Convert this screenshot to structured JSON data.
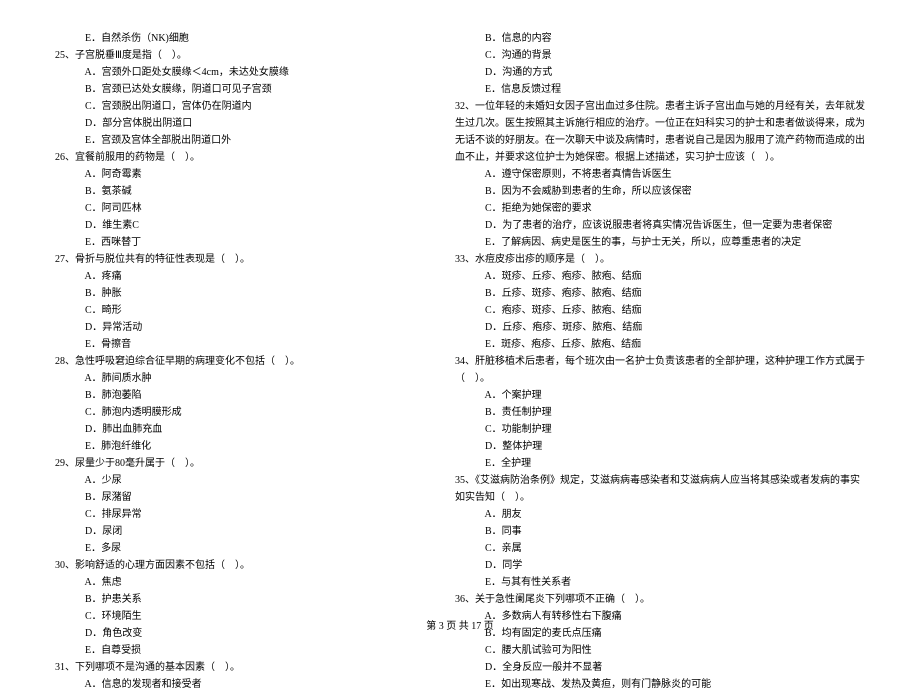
{
  "col1": [
    {
      "indent": 3,
      "text": "E．自然杀伤（NK)细胞"
    },
    {
      "indent": 0,
      "text": "25、子宫脱垂Ⅲ度是指（    ）。"
    },
    {
      "indent": 3,
      "text": "A．宫颈外口距处女膜缘＜4cm，未达处女膜缘"
    },
    {
      "indent": 3,
      "text": "B．宫颈已达处女膜缘，阴道口可见子宫颈"
    },
    {
      "indent": 3,
      "text": "C．宫颈脱出阴道口，宫体仍在阴道内"
    },
    {
      "indent": 3,
      "text": "D．部分宫体脱出阴道口"
    },
    {
      "indent": 3,
      "text": "E．宫颈及宫体全部脱出阴道口外"
    },
    {
      "indent": 0,
      "text": "26、宜餐前服用的药物是（    ）。"
    },
    {
      "indent": 3,
      "text": "A．阿奇霉素"
    },
    {
      "indent": 3,
      "text": "B．氨茶碱"
    },
    {
      "indent": 3,
      "text": "C．阿司匹林"
    },
    {
      "indent": 3,
      "text": "D．维生素C"
    },
    {
      "indent": 3,
      "text": "E．西咪替丁"
    },
    {
      "indent": 0,
      "text": "27、骨折与脱位共有的特征性表现是（    ）。"
    },
    {
      "indent": 3,
      "text": "A．疼痛"
    },
    {
      "indent": 3,
      "text": "B．肿胀"
    },
    {
      "indent": 3,
      "text": "C．畸形"
    },
    {
      "indent": 3,
      "text": "D．异常活动"
    },
    {
      "indent": 3,
      "text": "E．骨擦音"
    },
    {
      "indent": 0,
      "text": "28、急性呼吸窘迫综合征早期的病理变化不包括（    ）。"
    },
    {
      "indent": 3,
      "text": "A．肺间质水肿"
    },
    {
      "indent": 3,
      "text": "B．肺泡萎陷"
    },
    {
      "indent": 3,
      "text": "C．肺泡内透明膜形成"
    },
    {
      "indent": 3,
      "text": "D．肺出血肺充血"
    },
    {
      "indent": 3,
      "text": "E．肺泡纤维化"
    },
    {
      "indent": 0,
      "text": "29、尿量少于80毫升属于（    ）。"
    },
    {
      "indent": 3,
      "text": "A．少尿"
    },
    {
      "indent": 3,
      "text": "B．尿潴留"
    },
    {
      "indent": 3,
      "text": "C．排尿异常"
    },
    {
      "indent": 3,
      "text": "D．尿闭"
    },
    {
      "indent": 3,
      "text": "E．多尿"
    },
    {
      "indent": 0,
      "text": "30、影响舒适的心理方面因素不包括（    ）。"
    },
    {
      "indent": 3,
      "text": "A．焦虑"
    },
    {
      "indent": 3,
      "text": "B．护患关系"
    },
    {
      "indent": 3,
      "text": "C．环境陌生"
    },
    {
      "indent": 3,
      "text": "D．角色改变"
    },
    {
      "indent": 3,
      "text": "E．自尊受损"
    },
    {
      "indent": 0,
      "text": "31、下列哪项不是沟通的基本因素（    ）。"
    },
    {
      "indent": 3,
      "text": "A．信息的发现者和接受者"
    }
  ],
  "col2": [
    {
      "indent": 3,
      "text": "B．信息的内容"
    },
    {
      "indent": 3,
      "text": "C．沟通的背景"
    },
    {
      "indent": 3,
      "text": "D．沟通的方式"
    },
    {
      "indent": 3,
      "text": "E．信息反馈过程"
    },
    {
      "indent": 0,
      "text": "32、一位年轻的未婚妇女因子宫出血过多住院。患者主诉子宫出血与她的月经有关，去年就发"
    },
    {
      "indent": 0,
      "text": "生过几次。医生按照其主诉施行相应的治疗。一位正在妇科实习的护士和患者做谈得来，成为"
    },
    {
      "indent": 0,
      "text": "无话不谈的好朋友。在一次聊天中谈及病情时，患者说自己是因为服用了流产药物而造成的出"
    },
    {
      "indent": 0,
      "text": "血不止，并要求这位护士为她保密。根据上述描述，实习护士应该（    ）。"
    },
    {
      "indent": 3,
      "text": "A．遵守保密原则，不将患者真情告诉医生"
    },
    {
      "indent": 3,
      "text": "B．因为不会威胁到患者的生命，所以应该保密"
    },
    {
      "indent": 3,
      "text": "C．拒绝为她保密的要求"
    },
    {
      "indent": 3,
      "text": "D．为了患者的治疗，应该说服患者将真实情况告诉医生，但一定要为患者保密"
    },
    {
      "indent": 3,
      "text": "E．了解病因、病史是医生的事，与护士无关，所以，应尊重患者的决定"
    },
    {
      "indent": 0,
      "text": "33、水痘皮疹出疹的顺序是（    ）。"
    },
    {
      "indent": 3,
      "text": "A．斑疹、丘疹、疱疹、脓疱、结痂"
    },
    {
      "indent": 3,
      "text": "B．丘疹、斑疹、疱疹、脓疱、结痂"
    },
    {
      "indent": 3,
      "text": "C．疱疹、斑疹、丘疹、脓疱、结痂"
    },
    {
      "indent": 3,
      "text": "D．丘疹、疱疹、斑疹、脓疱、结痂"
    },
    {
      "indent": 3,
      "text": "E．斑疹、疱疹、丘疹、脓疱、结痂"
    },
    {
      "indent": 0,
      "text": "34、肝脏移植术后患者，每个班次由一名护士负责该患者的全部护理，这种护理工作方式属于"
    },
    {
      "indent": 0,
      "text": "（    ）。"
    },
    {
      "indent": 3,
      "text": "A．个案护理"
    },
    {
      "indent": 3,
      "text": "B．责任制护理"
    },
    {
      "indent": 3,
      "text": "C．功能制护理"
    },
    {
      "indent": 3,
      "text": "D．整体护理"
    },
    {
      "indent": 3,
      "text": "E．全护理"
    },
    {
      "indent": 0,
      "text": "35、《艾滋病防治条例》规定，艾滋病病毒感染者和艾滋病病人应当将其感染或者发病的事实"
    },
    {
      "indent": 0,
      "text": "如实告知（    ）。"
    },
    {
      "indent": 3,
      "text": "A．朋友"
    },
    {
      "indent": 3,
      "text": "B．同事"
    },
    {
      "indent": 3,
      "text": "C．亲属"
    },
    {
      "indent": 3,
      "text": "D．同学"
    },
    {
      "indent": 3,
      "text": "E．与其有性关系者"
    },
    {
      "indent": 0,
      "text": "36、关于急性阑尾炎下列哪项不正确（    ）。"
    },
    {
      "indent": 3,
      "text": "A．多数病人有转移性右下腹痛"
    },
    {
      "indent": 3,
      "text": "B．均有固定的麦氏点压痛"
    },
    {
      "indent": 3,
      "text": "C．腰大肌试验可为阳性"
    },
    {
      "indent": 3,
      "text": "D．全身反应一般并不显著"
    },
    {
      "indent": 3,
      "text": "E．如出现寒战、发热及黄疸，则有门静脉炎的可能"
    }
  ],
  "footer": "第 3 页 共 17 页"
}
